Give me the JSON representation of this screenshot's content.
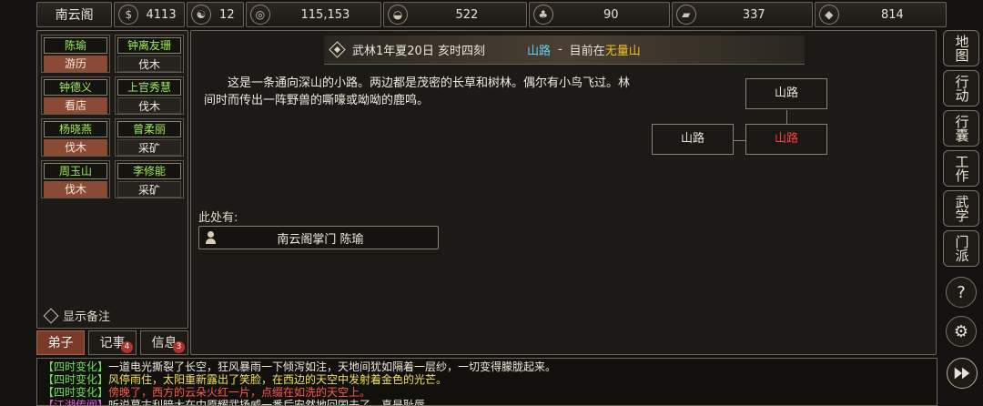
{
  "resources": {
    "sect_name": "南云阁",
    "items": [
      {
        "icon": "coin-bag-icon",
        "glyph": "💰",
        "value": "4113"
      },
      {
        "icon": "taiji-icon",
        "glyph": "☯",
        "value": "12"
      },
      {
        "icon": "copper-coin-icon",
        "glyph": "◎",
        "value": "115,153"
      },
      {
        "icon": "rice-bowl-icon",
        "glyph": "◒",
        "value": "522"
      },
      {
        "icon": "herb-icon",
        "glyph": "♣",
        "value": "90"
      },
      {
        "icon": "wood-icon",
        "glyph": "▰",
        "value": "337"
      },
      {
        "icon": "ore-icon",
        "glyph": "◆",
        "value": "814"
      }
    ]
  },
  "disciples": [
    {
      "name": "陈瑜",
      "task": "游历",
      "style": "busy"
    },
    {
      "name": "钟离友珊",
      "task": "伐木",
      "style": "dark"
    },
    {
      "name": "钟德义",
      "task": "看店",
      "style": "busy"
    },
    {
      "name": "上官秀慧",
      "task": "伐木",
      "style": "dark"
    },
    {
      "name": "杨晓燕",
      "task": "伐木",
      "style": "busy"
    },
    {
      "name": "曾柔丽",
      "task": "采矿",
      "style": "dark"
    },
    {
      "name": "周玉山",
      "task": "伐木",
      "style": "busy"
    },
    {
      "name": "李修能",
      "task": "采矿",
      "style": "dark"
    }
  ],
  "show_notes_label": "显示备注",
  "tabs": [
    {
      "label": "弟子",
      "badge": ""
    },
    {
      "label": "记事",
      "badge": "4"
    },
    {
      "label": "信息",
      "badge": "3"
    }
  ],
  "header": {
    "date": "武林1年夏20日 亥时四刻",
    "location": "山路",
    "dash": "-",
    "current_label": "目前在",
    "mountain": "无量山"
  },
  "description": "这是一条通向深山的小路。两边都是茂密的长草和树林。偶尔有小鸟飞过。林间时而传出一阵野兽的嘶嚎或呦呦的鹿鸣。",
  "map": {
    "north": "山路",
    "west": "山路",
    "current": "山路"
  },
  "here_label": "此处有:",
  "npc_label": "南云阁掌门 陈瑜",
  "side_menu": [
    {
      "name": "map",
      "label": "地图"
    },
    {
      "name": "action",
      "label": "行动"
    },
    {
      "name": "bag",
      "label": "行囊"
    },
    {
      "name": "work",
      "label": "工作"
    },
    {
      "name": "martial",
      "label": "武学"
    },
    {
      "name": "sect",
      "label": "门派"
    }
  ],
  "log": [
    {
      "tag": "【四时变化】",
      "tag_color": "green",
      "text": "一道电光撕裂了长空，狂风暴雨一下倾泻如注，天地间犹如隔着一层纱，一切变得朦胧起来。",
      "color": "white"
    },
    {
      "tag": "【四时变化】",
      "tag_color": "green",
      "text": "风停雨住，太阳重新露出了笑脸，在西边的天空中发射着金色的光芒。",
      "color": "yellow"
    },
    {
      "tag": "【四时变化】",
      "tag_color": "green",
      "text": "傍晚了，西方的云朵火红一片，点缀在如洗的天空上。",
      "color": "red"
    },
    {
      "tag": "【江湖传闻】",
      "tag_color": "magenta",
      "text": "听说慕古利暗大在中原耀武扬威一番后安然地回国去了，真是耻辱。",
      "color": "white"
    }
  ]
}
